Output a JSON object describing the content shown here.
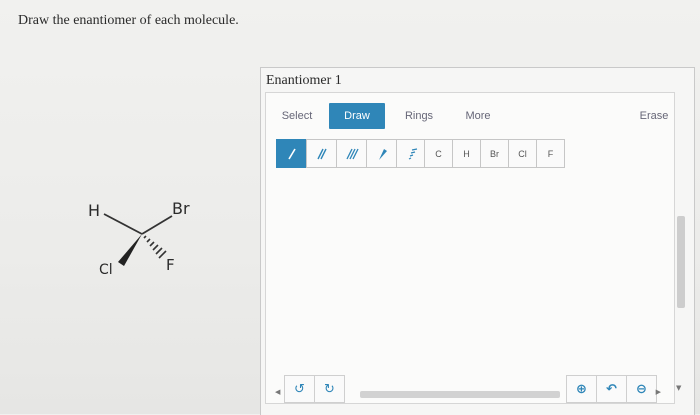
{
  "question": {
    "prompt": "Draw the enantiomer of each molecule."
  },
  "molecule": {
    "atoms": {
      "top_left": "H",
      "top_right": "Br",
      "bottom_left": "Cl",
      "bottom_right": "F"
    }
  },
  "panel": {
    "title": "Enantiomer 1"
  },
  "toolbar": {
    "tabs": {
      "select": "Select",
      "draw": "Draw",
      "rings": "Rings",
      "more": "More",
      "erase": "Erase"
    },
    "active_tab": "Draw"
  },
  "tools": {
    "bonds": [
      "single-bond-icon",
      "double-bond-icon",
      "triple-bond-icon",
      "wedge-bond-icon",
      "hash-bond-icon"
    ],
    "atoms": [
      "C",
      "H",
      "Br",
      "Cl",
      "F"
    ]
  },
  "colors": {
    "accent": "#2f86b8"
  }
}
